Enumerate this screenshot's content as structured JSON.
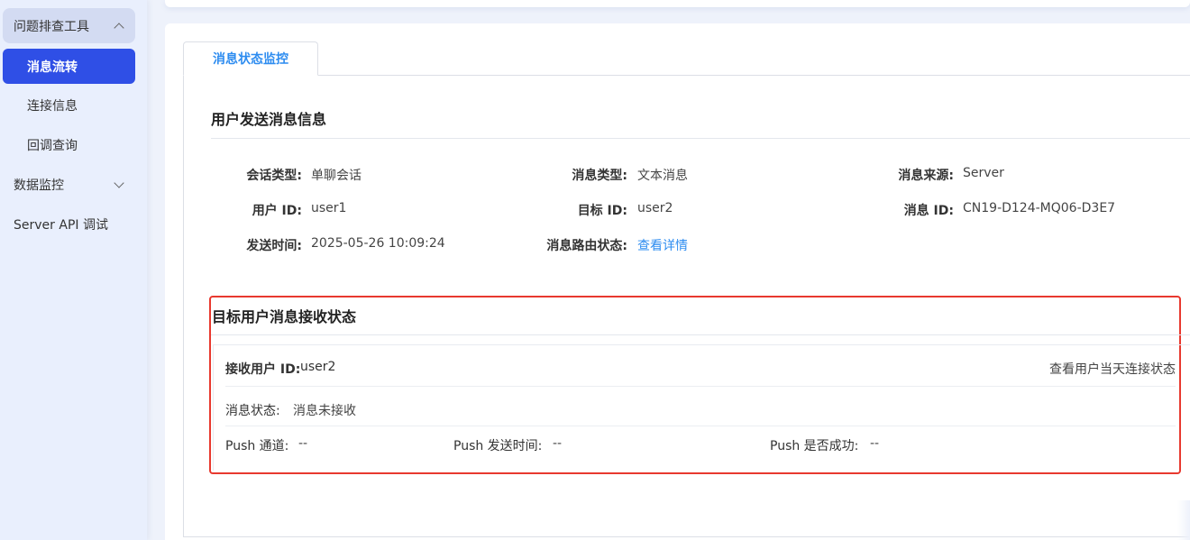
{
  "sidebar": {
    "group_label": "问题排查工具",
    "items": [
      {
        "label": "消息流转"
      },
      {
        "label": "连接信息"
      },
      {
        "label": "回调查询"
      }
    ],
    "data_monitor_label": "数据监控",
    "server_api_label": "Server API 调试"
  },
  "tab": {
    "label": "消息状态监控"
  },
  "send_info": {
    "title": "用户发送消息信息",
    "conversation_type_label": "会话类型:",
    "conversation_type_value": "单聊会话",
    "message_type_label": "消息类型:",
    "message_type_value": "文本消息",
    "message_source_label": "消息来源:",
    "message_source_value": "Server",
    "user_id_label": "用户 ID:",
    "user_id_value": "user1",
    "target_id_label": "目标 ID:",
    "target_id_value": "user2",
    "message_id_label": "消息 ID:",
    "message_id_value": "CN19-D124-MQ06-D3E7",
    "send_time_label": "发送时间:",
    "send_time_value": "2025-05-26 10:09:24",
    "route_status_label": "消息路由状态:",
    "route_status_link": "查看详情"
  },
  "receive_status": {
    "title": "目标用户消息接收状态",
    "receiver_label": "接收用户 ID:",
    "receiver_value": "user2",
    "connection_link": "查看用户当天连接状态",
    "msg_status_label": "消息状态:",
    "msg_status_value": "消息未接收",
    "push_channel_label": "Push 通道:",
    "push_channel_value": "--",
    "push_time_label": "Push 发送时间:",
    "push_time_value": "--",
    "push_success_label": "Push 是否成功:",
    "push_success_value": "--"
  }
}
